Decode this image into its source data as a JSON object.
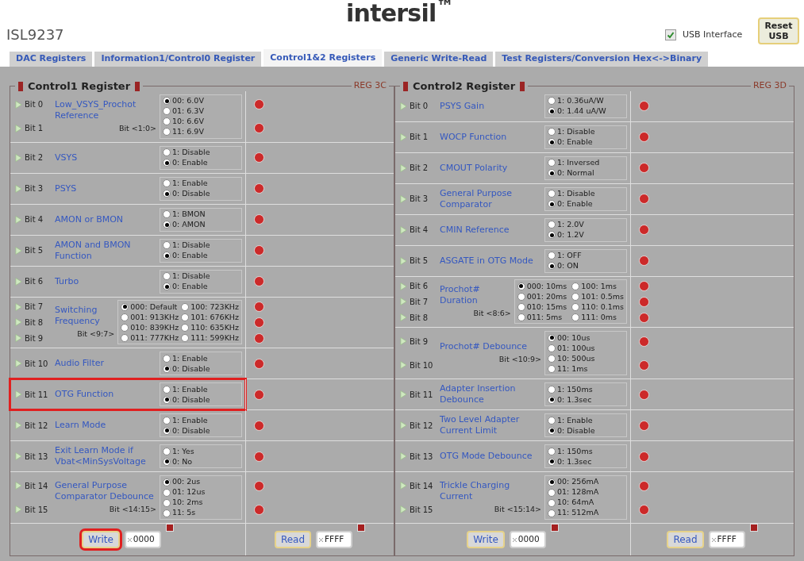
{
  "logo": "intersil$^{™}$",
  "device": "ISL9237",
  "usb_interface": {
    "label": "USB Interface",
    "checked": true
  },
  "reset_button": "Reset USB",
  "tabs": [
    {
      "label": "DAC Registers",
      "selected": false
    },
    {
      "label": "Information1/Control0 Register",
      "selected": false
    },
    {
      "label": "Control1&2 Registers",
      "selected": true
    },
    {
      "label": "Generic Write-Read",
      "selected": false
    },
    {
      "label": "Test Registers/Conversion Hex<->Binary",
      "selected": false
    }
  ],
  "panels": [
    {
      "title": "Control1 Register",
      "reg": "REG 3C",
      "rows": [
        {
          "bits": [
            "Bit 0",
            "Bit 1"
          ],
          "name": "Low_VSYS_Prochot Reference",
          "bit_range": "Bit <1:0>",
          "kind": "list",
          "highlighted": false,
          "options": [
            {
              "label": "00: 6.0V",
              "selected": true
            },
            {
              "label": "01: 6.3V",
              "selected": false
            },
            {
              "label": "10: 6.6V",
              "selected": false
            },
            {
              "label": "11: 6.9V",
              "selected": false
            }
          ]
        },
        {
          "bits": [
            "Bit 2"
          ],
          "name": "VSYS",
          "kind": "list",
          "highlighted": false,
          "options": [
            {
              "label": "1: Disable",
              "selected": false
            },
            {
              "label": "0: Enable",
              "selected": true
            }
          ]
        },
        {
          "bits": [
            "Bit 3"
          ],
          "name": "PSYS",
          "kind": "list",
          "highlighted": false,
          "options": [
            {
              "label": "1: Enable",
              "selected": false
            },
            {
              "label": "0: Disable",
              "selected": true
            }
          ]
        },
        {
          "bits": [
            "Bit 4"
          ],
          "name": "AMON or BMON",
          "kind": "list",
          "highlighted": false,
          "options": [
            {
              "label": "1: BMON",
              "selected": false
            },
            {
              "label": "0: AMON",
              "selected": true
            }
          ]
        },
        {
          "bits": [
            "Bit 5"
          ],
          "name": "AMON and BMON Function",
          "kind": "list",
          "highlighted": false,
          "options": [
            {
              "label": "1: Disable",
              "selected": false
            },
            {
              "label": "0: Enable",
              "selected": true
            }
          ]
        },
        {
          "bits": [
            "Bit 6"
          ],
          "name": "Turbo",
          "kind": "list",
          "highlighted": false,
          "options": [
            {
              "label": "1: Disable",
              "selected": false
            },
            {
              "label": "0: Enable",
              "selected": true
            }
          ]
        },
        {
          "bits": [
            "Bit 7",
            "Bit 8",
            "Bit 9"
          ],
          "name": "Switching Frequency",
          "bit_range": "Bit <9:7>",
          "kind": "grid",
          "highlighted": false,
          "options": [
            {
              "label": "000: Default",
              "selected": true
            },
            {
              "label": "100: 723KHz",
              "selected": false
            },
            {
              "label": "001: 913KHz",
              "selected": false
            },
            {
              "label": "101: 676KHz",
              "selected": false
            },
            {
              "label": "010: 839KHz",
              "selected": false
            },
            {
              "label": "110: 635KHz",
              "selected": false
            },
            {
              "label": "011: 777KHz",
              "selected": false
            },
            {
              "label": "111: 599KHz",
              "selected": false
            }
          ]
        },
        {
          "bits": [
            "Bit 10"
          ],
          "name": "Audio Filter",
          "kind": "list",
          "highlighted": false,
          "options": [
            {
              "label": "1: Enable",
              "selected": false
            },
            {
              "label": "0: Disable",
              "selected": true
            }
          ]
        },
        {
          "bits": [
            "Bit 11"
          ],
          "name": "OTG Function",
          "kind": "list",
          "highlighted": true,
          "options": [
            {
              "label": "1: Enable",
              "selected": false
            },
            {
              "label": "0: Disable",
              "selected": true
            }
          ]
        },
        {
          "bits": [
            "Bit 12"
          ],
          "name": "Learn Mode",
          "kind": "list",
          "highlighted": false,
          "options": [
            {
              "label": "1: Enable",
              "selected": false
            },
            {
              "label": "0: Disable",
              "selected": true
            }
          ]
        },
        {
          "bits": [
            "Bit 13"
          ],
          "name": "Exit Learn Mode if Vbat<MinSysVoltage",
          "kind": "list",
          "highlighted": false,
          "options": [
            {
              "label": "1: Yes",
              "selected": false
            },
            {
              "label": "0: No",
              "selected": true
            }
          ]
        },
        {
          "bits": [
            "Bit 14",
            "Bit 15"
          ],
          "name": "General Purpose Comparator Debounce",
          "bit_range": "Bit <14:15>",
          "kind": "list",
          "highlighted": false,
          "options": [
            {
              "label": "00: 2us",
              "selected": true
            },
            {
              "label": "01: 12us",
              "selected": false
            },
            {
              "label": "10: 2ms",
              "selected": false
            },
            {
              "label": "11: 5s",
              "selected": false
            }
          ]
        }
      ],
      "write": {
        "label": "Write",
        "value": "0000",
        "highlighted": true
      },
      "read": {
        "label": "Read",
        "value": "FFFF"
      }
    },
    {
      "title": "Control2 Register",
      "reg": "REG 3D",
      "rows": [
        {
          "bits": [
            "Bit 0"
          ],
          "name": "PSYS Gain",
          "kind": "list",
          "highlighted": false,
          "options": [
            {
              "label": "1: 0.36uA/W",
              "selected": false
            },
            {
              "label": "0: 1.44 uA/W",
              "selected": true
            }
          ]
        },
        {
          "bits": [
            "Bit 1"
          ],
          "name": "WOCP Function",
          "kind": "list",
          "highlighted": false,
          "options": [
            {
              "label": "1: Disable",
              "selected": false
            },
            {
              "label": "0: Enable",
              "selected": true
            }
          ]
        },
        {
          "bits": [
            "Bit 2"
          ],
          "name": "CMOUT Polarity",
          "kind": "list",
          "highlighted": false,
          "options": [
            {
              "label": "1: Inversed",
              "selected": false
            },
            {
              "label": "0: Normal",
              "selected": true
            }
          ]
        },
        {
          "bits": [
            "Bit 3"
          ],
          "name": "General Purpose Comparator",
          "kind": "list",
          "highlighted": false,
          "options": [
            {
              "label": "1: Disable",
              "selected": false
            },
            {
              "label": "0: Enable",
              "selected": true
            }
          ]
        },
        {
          "bits": [
            "Bit 4"
          ],
          "name": "CMIN Reference",
          "kind": "list",
          "highlighted": false,
          "options": [
            {
              "label": "1: 2.0V",
              "selected": false
            },
            {
              "label": "0: 1.2V",
              "selected": true
            }
          ]
        },
        {
          "bits": [
            "Bit 5"
          ],
          "name": "ASGATE in OTG Mode",
          "kind": "list",
          "highlighted": false,
          "options": [
            {
              "label": "1: OFF",
              "selected": false
            },
            {
              "label": "0: ON",
              "selected": true
            }
          ]
        },
        {
          "bits": [
            "Bit 6",
            "Bit 7",
            "Bit 8"
          ],
          "name": "Prochot# Duration",
          "bit_range": "Bit <8:6>",
          "kind": "grid",
          "highlighted": false,
          "options": [
            {
              "label": "000: 10ms",
              "selected": true
            },
            {
              "label": "100: 1ms",
              "selected": false
            },
            {
              "label": "001: 20ms",
              "selected": false
            },
            {
              "label": "101: 0.5ms",
              "selected": false
            },
            {
              "label": "010: 15ms",
              "selected": false
            },
            {
              "label": "110: 0.1ms",
              "selected": false
            },
            {
              "label": "011: 5ms",
              "selected": false
            },
            {
              "label": "111: 0ms",
              "selected": false
            }
          ]
        },
        {
          "bits": [
            "Bit 9",
            "Bit 10"
          ],
          "name": "Prochot# Debounce",
          "bit_range": "Bit <10:9>",
          "kind": "list",
          "highlighted": false,
          "options": [
            {
              "label": "00: 10us",
              "selected": true
            },
            {
              "label": "01: 100us",
              "selected": false
            },
            {
              "label": "10: 500us",
              "selected": false
            },
            {
              "label": "11: 1ms",
              "selected": false
            }
          ]
        },
        {
          "bits": [
            "Bit 11"
          ],
          "name": "Adapter Insertion Debounce",
          "kind": "list",
          "highlighted": false,
          "options": [
            {
              "label": "1: 150ms",
              "selected": false
            },
            {
              "label": "0: 1.3sec",
              "selected": true
            }
          ]
        },
        {
          "bits": [
            "Bit 12"
          ],
          "name": "Two Level Adapter Current Limit",
          "kind": "list",
          "highlighted": false,
          "options": [
            {
              "label": "1: Enable",
              "selected": false
            },
            {
              "label": "0: Disable",
              "selected": true
            }
          ]
        },
        {
          "bits": [
            "Bit 13"
          ],
          "name": "OTG Mode Debounce",
          "kind": "list",
          "highlighted": false,
          "options": [
            {
              "label": "1: 150ms",
              "selected": false
            },
            {
              "label": "0: 1.3sec",
              "selected": true
            }
          ]
        },
        {
          "bits": [
            "Bit 14",
            "Bit 15"
          ],
          "name": "Trickle Charging Current",
          "bit_range": "Bit <15:14>",
          "kind": "list",
          "highlighted": false,
          "options": [
            {
              "label": "00: 256mA",
              "selected": true
            },
            {
              "label": "01: 128mA",
              "selected": false
            },
            {
              "label": "10: 64mA",
              "selected": false
            },
            {
              "label": "11: 512mA",
              "selected": false
            }
          ]
        }
      ],
      "write": {
        "label": "Write",
        "value": "0000",
        "highlighted": false
      },
      "read": {
        "label": "Read",
        "value": "FFFF"
      }
    }
  ]
}
